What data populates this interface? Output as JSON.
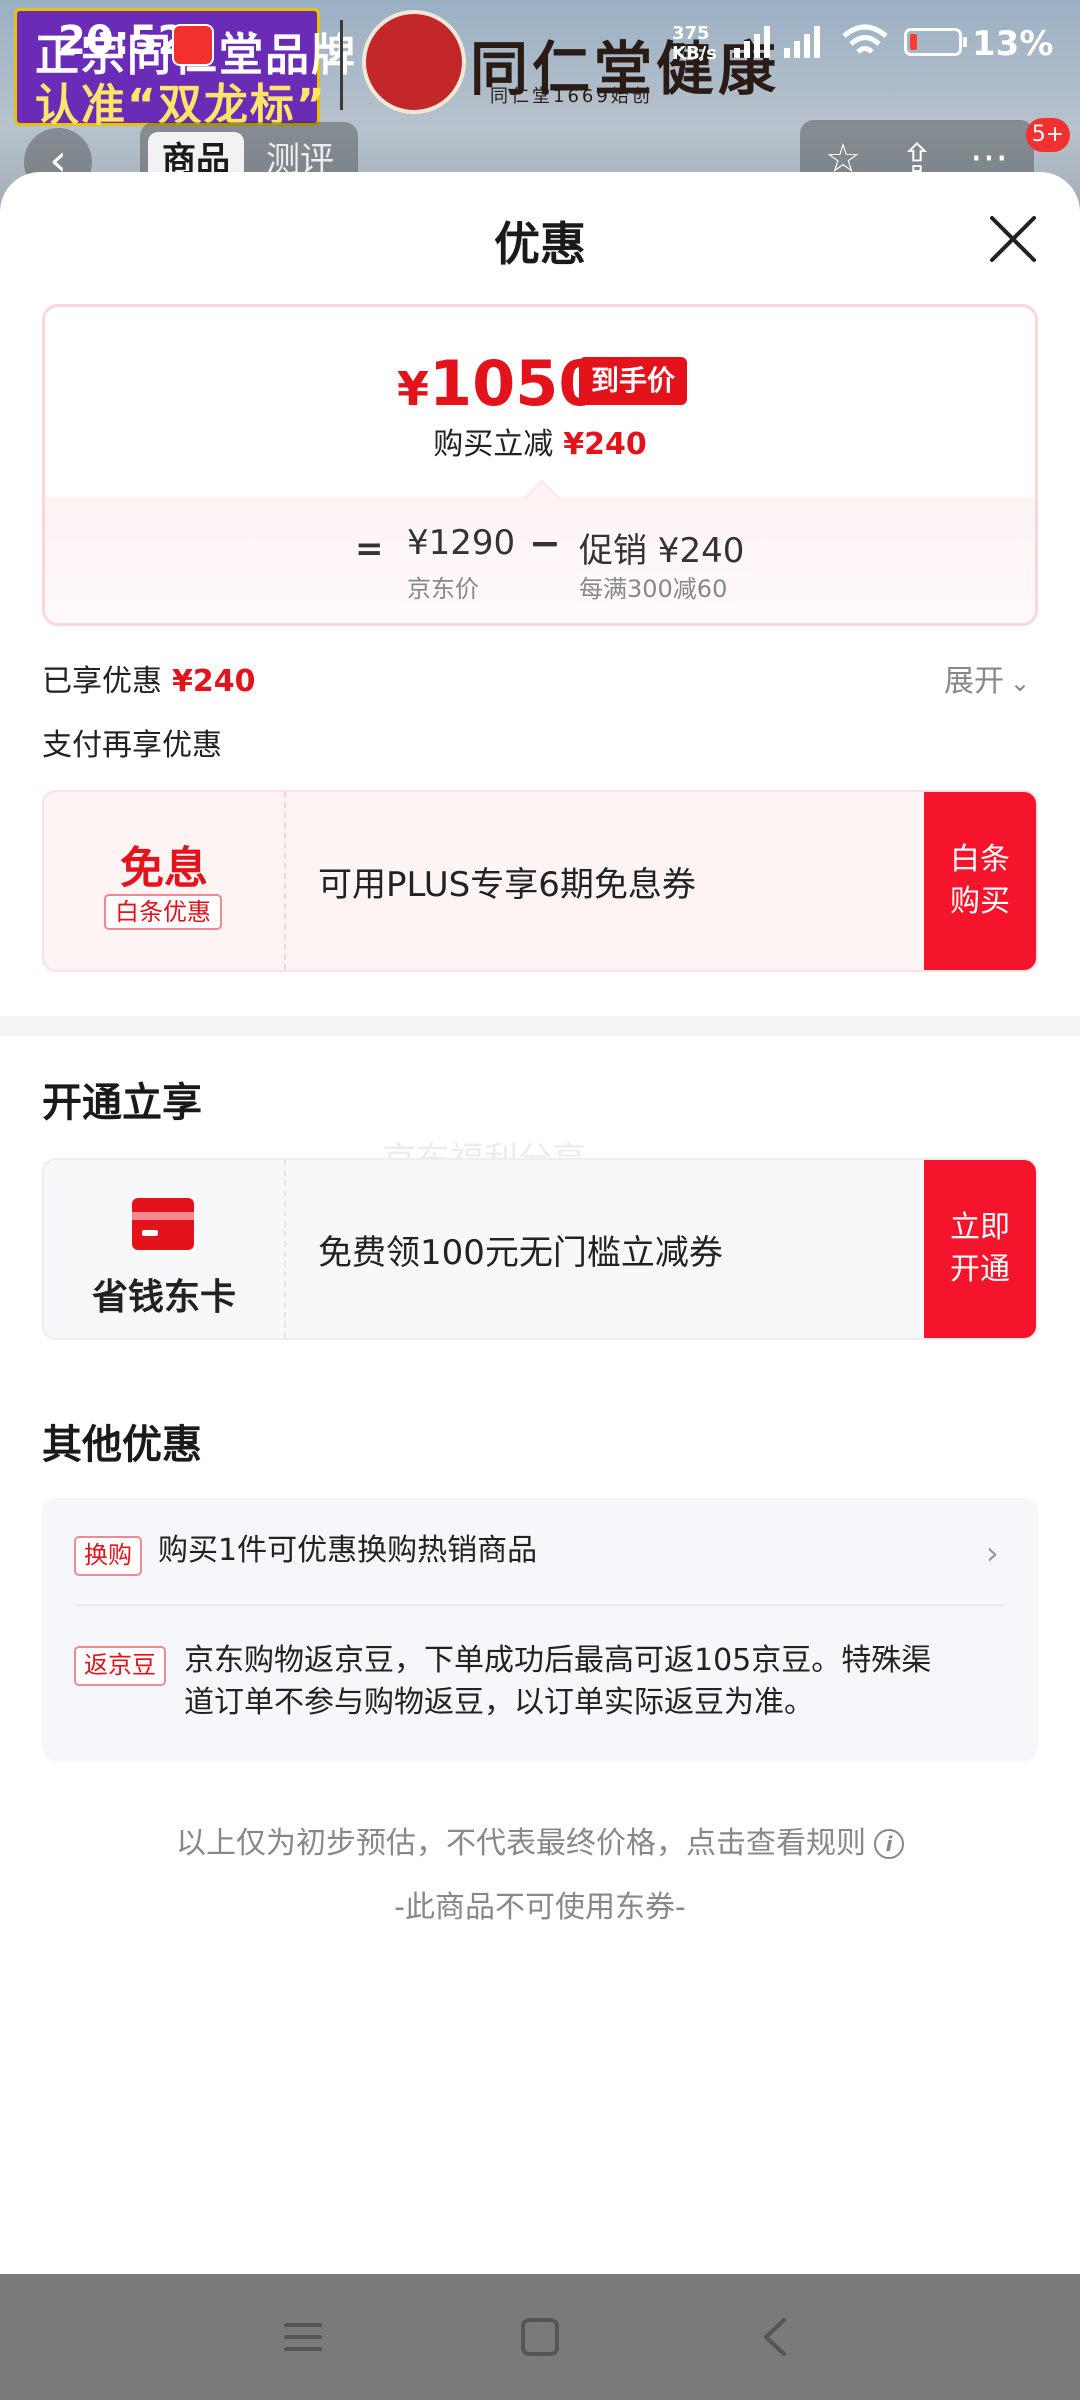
{
  "status_bar": {
    "time": "20:52",
    "network_speed_value": "375",
    "network_speed_unit": "KB/s",
    "battery_percent": "13%"
  },
  "background_page": {
    "banner_line1": "正宗同仁堂品牌",
    "banner_line2": "认准“双龙标”",
    "brand_name": "同仁堂健康",
    "brand_sub": "同仁堂1669始创",
    "tabs": [
      "商品",
      "测评"
    ],
    "notification_badge": "5+"
  },
  "sheet": {
    "title": "优惠",
    "price_card": {
      "currency": "¥",
      "final_price": "1050",
      "final_tag": "到手价",
      "reduce_label": "购买立减",
      "reduce_amount": "¥240",
      "eq": "=",
      "jd_price": "¥1290",
      "jd_price_label": "京东价",
      "minus": "−",
      "promo": "促销 ¥240",
      "promo_rule": "每满300减60"
    },
    "enjoyed_label": "已享优惠",
    "enjoyed_amount": "¥240",
    "expand_label": "展开",
    "pay_more_label": "支付再享优惠",
    "baitiao": {
      "big": "免息",
      "chip": "白条优惠",
      "text": "可用PLUS专享6期免息券",
      "button": "白条\n购买"
    },
    "open_section_title": "开通立享",
    "watermark": "京东福利分享",
    "card_offer": {
      "name": "省钱东卡",
      "text": "免费领100元无门槛立减券",
      "button": "立即\n开通"
    },
    "other_section_title": "其他优惠",
    "other_offers": [
      {
        "tag": "换购",
        "text": "购买1件可优惠换购热销商品"
      },
      {
        "tag": "返京豆",
        "text_line1": "京东购物返京豆，下单成功后最高可返105京豆。特殊渠",
        "text_line2": "道订单不参与购物返豆，以订单实际返豆为准。"
      }
    ],
    "disclaimer": "以上仅为初步预估，不代表最终价格，点击查看规则",
    "no_coupon": "-此商品不可使用东券-"
  },
  "colors": {
    "accent_red": "#e4131b",
    "button_red": "#f5142b",
    "nav_bar": "#7a7a7a"
  }
}
